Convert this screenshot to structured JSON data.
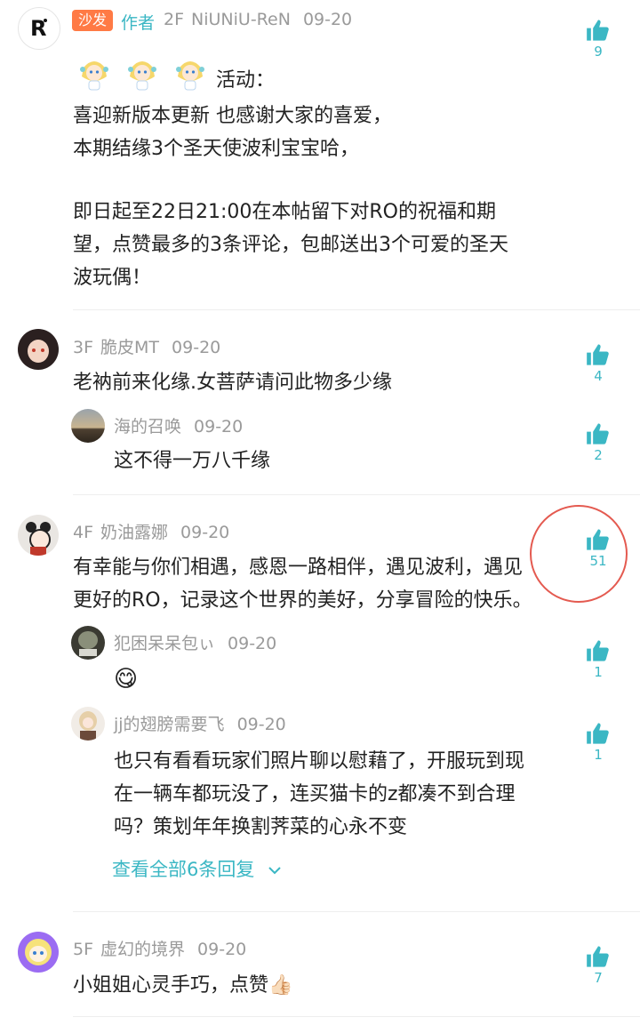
{
  "comments": [
    {
      "badge": "沙发",
      "author_tag": "作者",
      "floor": "2F",
      "name": "NiUNiU-ReN",
      "date": "09-20",
      "likes": "9",
      "lines": [
        "活动：",
        "喜迎新版本更新 也感谢大家的喜爱，",
        "本期结缘3个圣天使波利宝宝哈，",
        "",
        "即日起至22日21:00在本帖留下对RO的祝福和期",
        "望，点赞最多的3条评论，包邮送出3个可爱的圣天",
        "波玩偶！"
      ]
    },
    {
      "floor": "3F",
      "name": "脆皮MT",
      "date": "09-20",
      "likes": "4",
      "text": "老衲前来化缘.女菩萨请问此物多少缘",
      "replies": [
        {
          "name": "海的召唤",
          "date": "09-20",
          "likes": "2",
          "text": "这不得一万八千缘"
        }
      ]
    },
    {
      "floor": "4F",
      "name": "奶油露娜",
      "date": "09-20",
      "likes": "51",
      "lines": [
        "有幸能与你们相遇，感恩一路相伴，遇见波利，遇见",
        "更好的RO，记录这个世界的美好，分享冒险的快乐。"
      ],
      "replies": [
        {
          "name": "犯困呆呆包ぃ",
          "date": "09-20",
          "likes": "1",
          "emoji": "😋"
        },
        {
          "name": "jj的翅膀需要飞",
          "date": "09-20",
          "likes": "1",
          "lines": [
            "也只有看看玩家们照片聊以慰藉了，开服玩到现",
            "在一辆车都玩没了，连买猫卡的z都凑不到合理",
            "吗？策划年年换割荠菜的心永不变"
          ]
        }
      ],
      "view_all": "查看全部6条回复"
    },
    {
      "floor": "5F",
      "name": "虚幻的境界",
      "date": "09-20",
      "likes": "7",
      "text": "小姐姐心灵手巧，点赞👍🏻"
    }
  ],
  "colors": {
    "accent": "#3bb7c4",
    "badge_bg": "#ff7a45",
    "author_tag": "#3bb7c4",
    "meta": "#9a9a9a",
    "highlight_circle": "#e45a50"
  },
  "icons": [
    "avatar",
    "thumbs-up-icon",
    "chevron-down-icon",
    "sticker-icon"
  ]
}
